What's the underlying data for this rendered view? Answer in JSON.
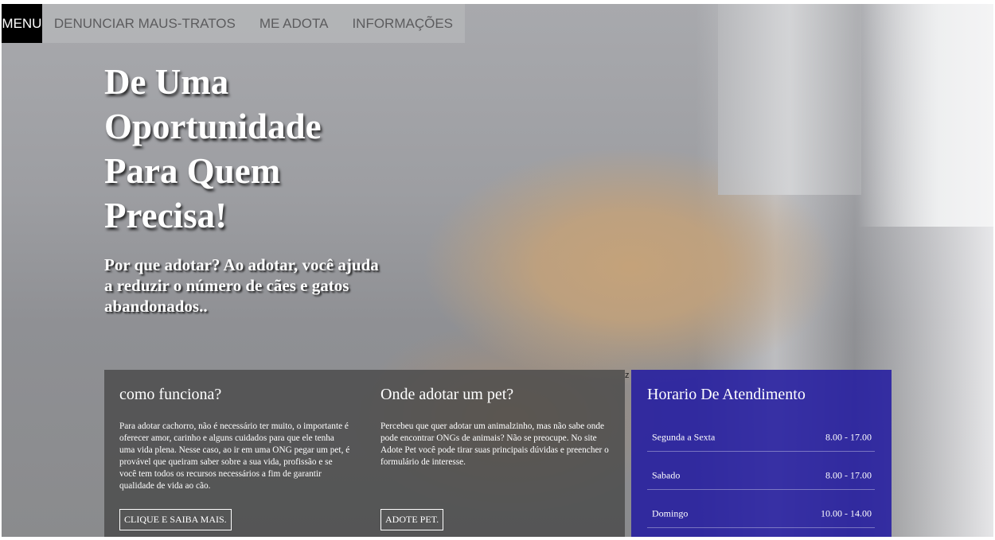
{
  "nav": {
    "menu": "MENU",
    "items": [
      "DENUNCIAR MAUS-TRATOS",
      "ME ADOTA",
      "INFORMAÇÕES"
    ]
  },
  "hero": {
    "headline": "De Uma Oportunidade Para Quem Precisa!",
    "subtitle": "Por que adotar? Ao adotar, você ajuda a reduzir o número de cães e gatos abandonados.."
  },
  "stray_char": "z",
  "info": {
    "how": {
      "title": "como funciona?",
      "text": "Para adotar cachorro, não é necessário ter muito, o importante é oferecer amor, carinho e alguns cuidados para que ele tenha uma vida plena. Nesse caso, ao ir em uma ONG pegar um pet, é provável que queiram saber sobre a sua vida, profissão e se você tem todos os recursos necessários a fim de garantir qualidade de vida ao cão.",
      "button": "CLIQUE E SAIBA MAIS."
    },
    "where": {
      "title": "Onde adotar um pet?",
      "text": "Percebeu que quer adotar um animalzinho, mas não sabe onde pode encontrar ONGs de animais? Não se preocupe. No site Adote Pet você pode tirar suas principais dúvidas e preencher o formulário de interesse.",
      "button": "ADOTE PET."
    }
  },
  "hours": {
    "title": "Horario De Atendimento",
    "rows": [
      {
        "day": "Segunda a Sexta",
        "time": "8.00 - 17.00"
      },
      {
        "day": "Sabado",
        "time": "8.00 - 17.00"
      },
      {
        "day": "Domingo",
        "time": "10.00 - 14.00"
      }
    ]
  },
  "colors": {
    "hours_panel": "#241ca0",
    "info_panel": "#464646",
    "nav_bg": "#b4b5b7",
    "menu_bg": "#000000"
  }
}
